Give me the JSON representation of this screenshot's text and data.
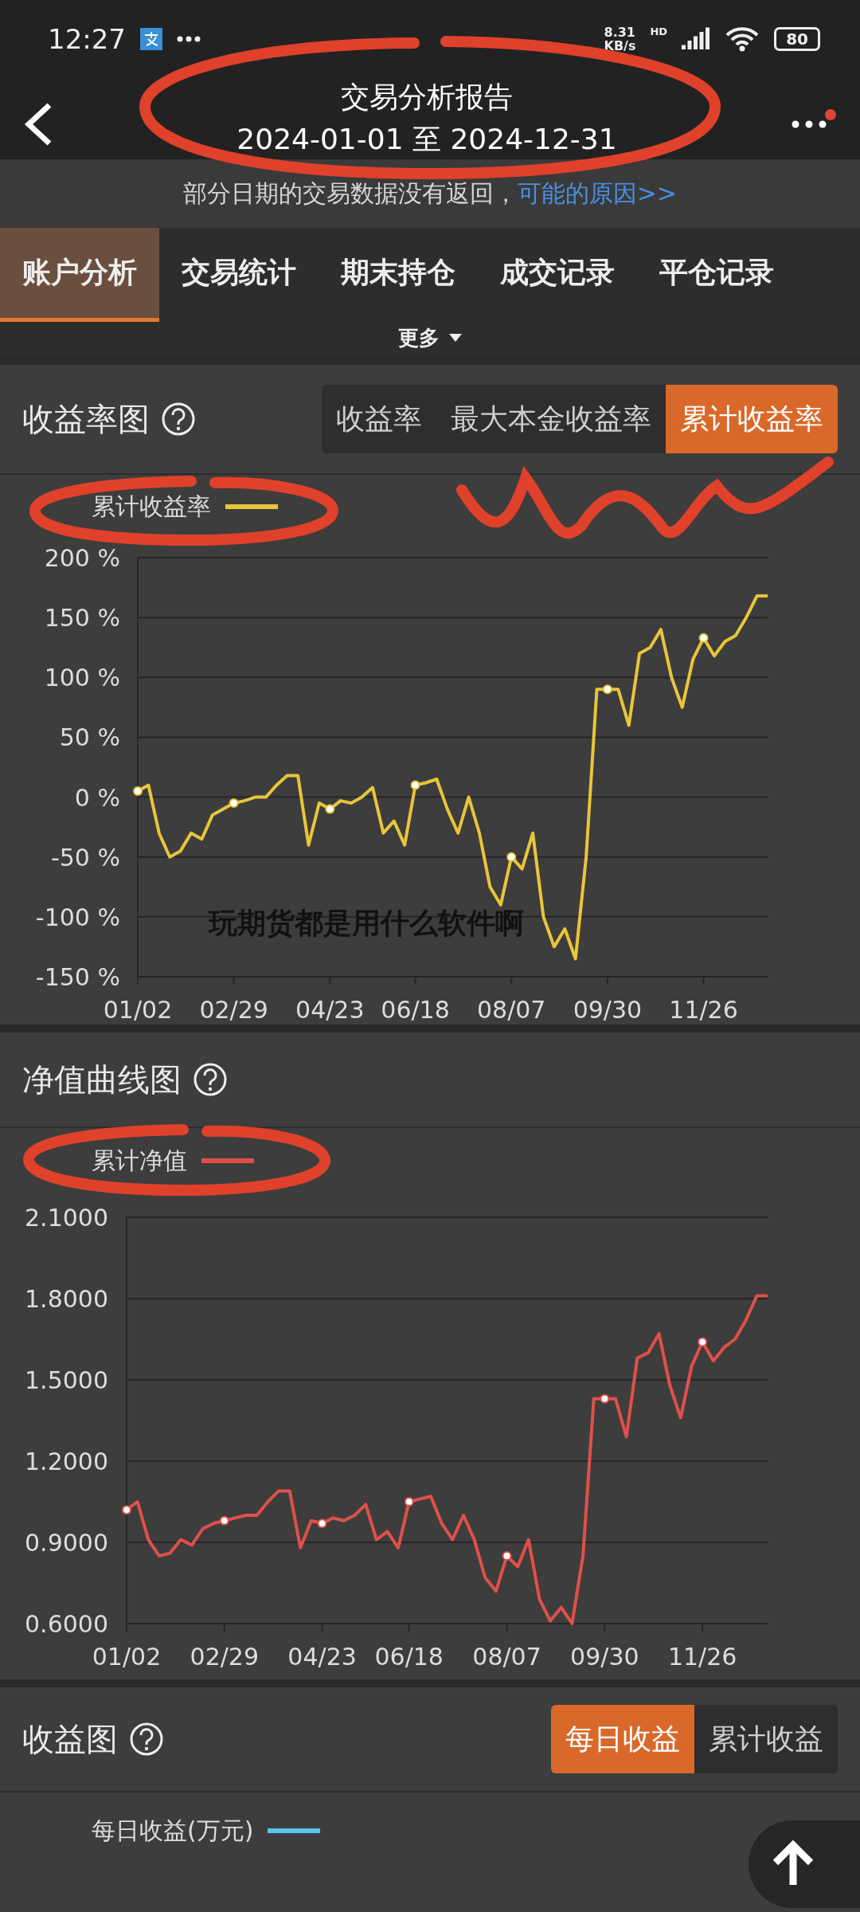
{
  "status_bar": {
    "time": "12:27",
    "net_speed": "8.31",
    "net_unit": "KB/s",
    "hd": "HD",
    "battery": "80"
  },
  "header": {
    "title": "交易分析报告",
    "subtitle": "2024-01-01 至 2024-12-31"
  },
  "notice": {
    "text": "部分日期的交易数据没有返回，",
    "link": "可能的原因>>"
  },
  "tabs": [
    {
      "label": "账户分析",
      "selected": true
    },
    {
      "label": "交易统计",
      "selected": false
    },
    {
      "label": "期末持仓",
      "selected": false
    },
    {
      "label": "成交记录",
      "selected": false
    },
    {
      "label": "平仓记录",
      "selected": false
    }
  ],
  "more": {
    "label": "更多"
  },
  "yield_section": {
    "title": "收益率图",
    "segments": [
      {
        "label": "收益率",
        "selected": false
      },
      {
        "label": "最大本金收益率",
        "selected": false
      },
      {
        "label": "累计收益率",
        "selected": true
      }
    ],
    "chart_data": {
      "type": "line",
      "grid": true,
      "categories": [
        "01/02",
        null,
        null,
        null,
        null,
        null,
        null,
        null,
        null,
        "02/29",
        null,
        null,
        null,
        null,
        null,
        null,
        null,
        null,
        "04/23",
        null,
        null,
        null,
        null,
        null,
        null,
        null,
        "06/18",
        null,
        null,
        null,
        null,
        null,
        null,
        null,
        null,
        "08/07",
        null,
        null,
        null,
        null,
        null,
        null,
        null,
        null,
        "09/30",
        null,
        null,
        null,
        null,
        null,
        null,
        null,
        null,
        "11/26",
        null,
        null,
        null,
        null,
        null,
        null
      ],
      "series": [
        {
          "name": "累计收益率",
          "color": "#e8c53a",
          "values": [
            5,
            10,
            -30,
            -50,
            -45,
            -30,
            -35,
            -15,
            -10,
            -5,
            -3,
            0,
            0,
            10,
            18,
            18,
            -40,
            -5,
            -10,
            -3,
            -5,
            0,
            8,
            -30,
            -20,
            -40,
            10,
            12,
            15,
            -10,
            -30,
            0,
            -30,
            -75,
            -90,
            -50,
            -60,
            -30,
            -100,
            -125,
            -110,
            -135,
            -50,
            90,
            90,
            90,
            60,
            120,
            125,
            140,
            100,
            75,
            115,
            133,
            118,
            130,
            135,
            150,
            168,
            168
          ]
        }
      ],
      "ylim": [
        -150,
        200
      ],
      "yticks": [
        {
          "value": 200,
          "label": "200 %"
        },
        {
          "value": 150,
          "label": "150 %"
        },
        {
          "value": 100,
          "label": "100 %"
        },
        {
          "value": 50,
          "label": "50 %"
        },
        {
          "value": 0,
          "label": "0 %"
        },
        {
          "value": -50,
          "label": "-50 %"
        },
        {
          "value": -100,
          "label": "-100 %"
        },
        {
          "value": -150,
          "label": "-150 %"
        }
      ]
    }
  },
  "nav_section": {
    "title": "净值曲线图",
    "chart_data": {
      "type": "line",
      "grid": true,
      "categories": [
        "01/02",
        null,
        null,
        null,
        null,
        null,
        null,
        null,
        null,
        "02/29",
        null,
        null,
        null,
        null,
        null,
        null,
        null,
        null,
        "04/23",
        null,
        null,
        null,
        null,
        null,
        null,
        null,
        "06/18",
        null,
        null,
        null,
        null,
        null,
        null,
        null,
        null,
        "08/07",
        null,
        null,
        null,
        null,
        null,
        null,
        null,
        null,
        "09/30",
        null,
        null,
        null,
        null,
        null,
        null,
        null,
        null,
        "11/26",
        null,
        null,
        null,
        null,
        null,
        null
      ],
      "series": [
        {
          "name": "累计净值",
          "color": "#e0504a",
          "values": [
            1.02,
            1.05,
            0.91,
            0.85,
            0.86,
            0.91,
            0.89,
            0.95,
            0.97,
            0.98,
            0.99,
            1.0,
            1.0,
            1.05,
            1.09,
            1.09,
            0.88,
            0.98,
            0.97,
            0.99,
            0.98,
            1.0,
            1.04,
            0.91,
            0.94,
            0.88,
            1.05,
            1.06,
            1.07,
            0.97,
            0.91,
            1.0,
            0.91,
            0.77,
            0.72,
            0.85,
            0.81,
            0.91,
            0.69,
            0.61,
            0.66,
            0.6,
            0.85,
            1.43,
            1.43,
            1.43,
            1.29,
            1.58,
            1.6,
            1.67,
            1.48,
            1.36,
            1.55,
            1.64,
            1.57,
            1.62,
            1.65,
            1.72,
            1.81,
            1.81
          ]
        }
      ],
      "ylim": [
        0.6,
        2.1
      ],
      "yticks": [
        {
          "value": 2.1,
          "label": "2.1000"
        },
        {
          "value": 1.8,
          "label": "1.8000"
        },
        {
          "value": 1.5,
          "label": "1.5000"
        },
        {
          "value": 1.2,
          "label": "1.2000"
        },
        {
          "value": 0.9,
          "label": "0.9000"
        },
        {
          "value": 0.6,
          "label": "0.6000"
        }
      ]
    }
  },
  "profit_section": {
    "title": "收益图",
    "segments": [
      {
        "label": "每日收益",
        "selected": true
      },
      {
        "label": "累计收益",
        "selected": false
      }
    ],
    "legend": {
      "label": "每日收益(万元)",
      "color": "#5bc0eb"
    }
  },
  "caption": "玩期货都是用什么软件啊"
}
